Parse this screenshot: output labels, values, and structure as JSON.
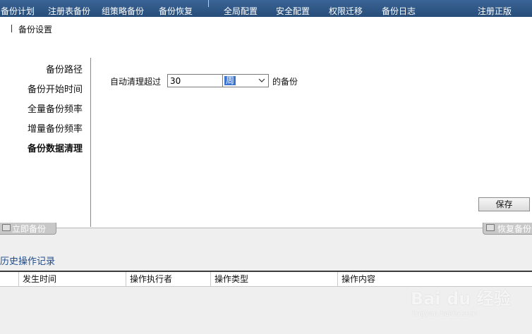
{
  "nav": {
    "items": [
      "备份计划",
      "注册表备份",
      "组策略备份",
      "备份恢复",
      "全局配置",
      "安全配置",
      "权限迁移",
      "备份日志",
      "注册正版"
    ]
  },
  "backup_settings": {
    "title": "备份设置",
    "menu": [
      "备份路径",
      "备份开始时间",
      "全量备份频率",
      "增量备份频率",
      "备份数据清理"
    ],
    "active_item": "备份数据清理",
    "form": {
      "label": "自动清理超过",
      "value": "30",
      "unit_selected": "周",
      "suffix": "的备份"
    },
    "save_label": "保存"
  },
  "tabs": {
    "left_label": "立即备份",
    "right_label": "恢复备份"
  },
  "history": {
    "title": "历史操作记录",
    "columns": [
      "发生时间",
      "操作执行者",
      "操作类型",
      "操作内容"
    ]
  },
  "watermark": {
    "brand": "Bai du 经验",
    "url": "jingyan.baidu.com"
  },
  "colors": {
    "nav_bg": "#2f5a8a",
    "select_highlight": "#3874d0",
    "history_title": "#1f4b8a"
  }
}
